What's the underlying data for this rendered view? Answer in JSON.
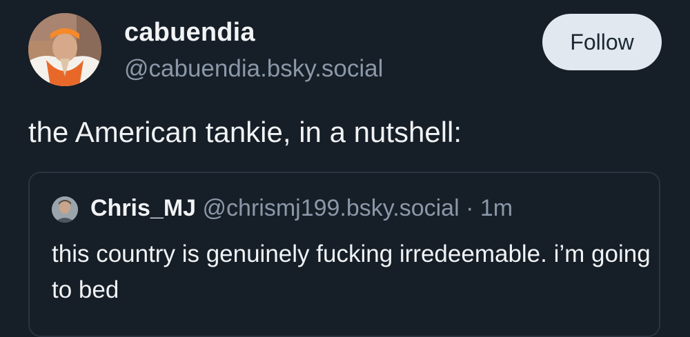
{
  "author": {
    "display_name": "cabuendia",
    "handle": "@cabuendia.bsky.social",
    "avatar_icon": "user-avatar"
  },
  "follow_button": {
    "label": "Follow"
  },
  "post": {
    "text": "the American tankie, in a nutshell:"
  },
  "quote": {
    "display_name": "Chris_MJ",
    "handle": "@chrismj199.bsky.social",
    "separator": "·",
    "timestamp": "1m",
    "text": "this country is genuinely fucking irredeemable. i’m going to bed"
  },
  "colors": {
    "background": "#161e27",
    "text_primary": "#f1f3f5",
    "text_secondary": "#8b98a9",
    "button_bg": "#e1e8ef",
    "card_border": "#2a3440"
  }
}
